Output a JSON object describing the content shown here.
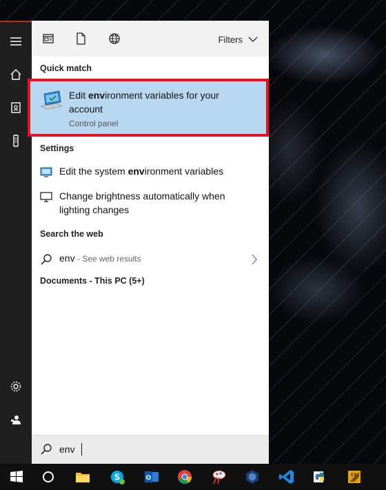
{
  "colors": {
    "accent": "#e81123",
    "selection": "#b8d8f2",
    "rail": "#1f1f1f",
    "taskbar": "#101010",
    "panel": "#f2f2f2"
  },
  "rail": {
    "items": [
      {
        "icon": "hamburger-icon"
      },
      {
        "icon": "home-icon"
      },
      {
        "icon": "notebook-icon"
      },
      {
        "icon": "device-icon"
      },
      {
        "icon": "settings-icon"
      },
      {
        "icon": "feedback-icon"
      }
    ]
  },
  "toolbar": {
    "icons": [
      "apps-filter-icon",
      "documents-filter-icon",
      "web-filter-icon"
    ],
    "filters_label": "Filters"
  },
  "sections": {
    "quick_match": "Quick match",
    "settings": "Settings",
    "search_web": "Search the web",
    "documents": "Documents - This PC (5+)"
  },
  "quick_match": {
    "title_prefix": "Edit ",
    "title_highlight": "env",
    "title_suffix": "ironment variables for your account",
    "subtitle": "Control panel",
    "icon": "control-panel-icon"
  },
  "settings_results": [
    {
      "prefix": "Edit the system ",
      "highlight": "env",
      "suffix": "ironment variables",
      "icon": "monitor-settings-icon"
    },
    {
      "prefix": "Change brightness automatically when lighting changes",
      "highlight": "",
      "suffix": "",
      "icon": "monitor-icon"
    }
  ],
  "web_search": {
    "query": "env",
    "hint": " - See web results"
  },
  "search": {
    "value": "env"
  },
  "taskbar": {
    "apps": [
      "windows-start-icon",
      "cortana-icon",
      "file-explorer-icon",
      "skype-icon",
      "outlook-icon",
      "chrome-icon",
      "paint-tool-icon",
      "virtualbox-icon",
      "vscode-icon",
      "python-icon",
      "app-icon"
    ]
  }
}
